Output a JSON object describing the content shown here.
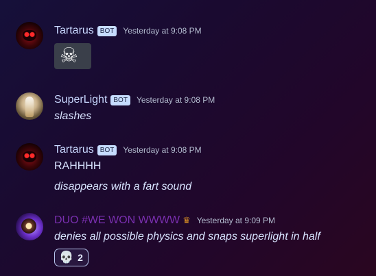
{
  "messages": [
    {
      "author": "Tartarus",
      "badge": "BOT",
      "timestamp": "Yesterday at 9:08 PM",
      "emoji": "☠"
    },
    {
      "author": "SuperLight",
      "badge": "BOT",
      "timestamp": "Yesterday at 9:08 PM",
      "lines": [
        "slashes"
      ]
    },
    {
      "author": "Tartarus",
      "badge": "BOT",
      "timestamp": "Yesterday at 9:08 PM",
      "lines": [
        "RAHHHH",
        "disappears with a fart sound"
      ]
    },
    {
      "author": "DUO #WE WON WWWW",
      "role_icon": "♛",
      "timestamp": "Yesterday at 9:09 PM",
      "lines": [
        "denies all possible physics and snaps superlight in half"
      ],
      "reaction": {
        "emoji": "💀",
        "count": "2"
      }
    }
  ],
  "colors": {
    "author_default": "#c9d8ff",
    "author_duo": "#7a2fb0",
    "bot_badge_bg": "#c6dcff",
    "timestamp": "#b3bbcf",
    "crown": "#d08a25"
  },
  "icons": {
    "emoji_tile": "skull-and-crossbones-icon",
    "reaction": "skull-icon",
    "role": "crown-icon"
  }
}
